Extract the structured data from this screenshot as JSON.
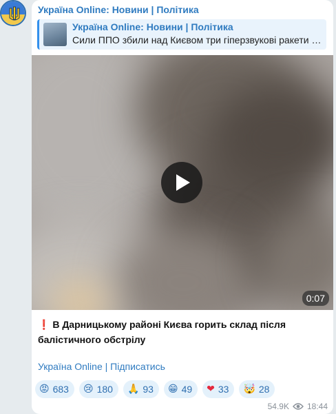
{
  "channel": {
    "name": "Україна Online: Новини | Політика"
  },
  "reply": {
    "title": "Україна Online: Новини | Політика",
    "text": "Сили ППО збили над Києвом три гіперзвукові ракети …"
  },
  "video": {
    "duration": "0:07"
  },
  "message": {
    "emoji": "❗",
    "text": "В Дарницькому районі Києва горить склад після балістичного обстрілу"
  },
  "footer": {
    "link": "Україна Online | Підписатись"
  },
  "reactions": [
    {
      "icon": "angry-face",
      "emoji": "😡",
      "count": "683"
    },
    {
      "icon": "crying-face",
      "emoji": "😢",
      "count": "180"
    },
    {
      "icon": "praying-hands",
      "emoji": "🙏",
      "count": "93"
    },
    {
      "icon": "smiling-face",
      "emoji": "😁",
      "count": "49"
    },
    {
      "icon": "red-heart",
      "emoji": "❤",
      "count": "33"
    },
    {
      "icon": "exploding-head",
      "emoji": "🤯",
      "count": "28"
    }
  ],
  "meta": {
    "views": "54.9K",
    "time": "18:44"
  },
  "colors": {
    "accent": "#2f7bc0",
    "bubble": "#ffffff",
    "background": "#e6ebee",
    "reaction_bg": "#e4f1fb"
  }
}
